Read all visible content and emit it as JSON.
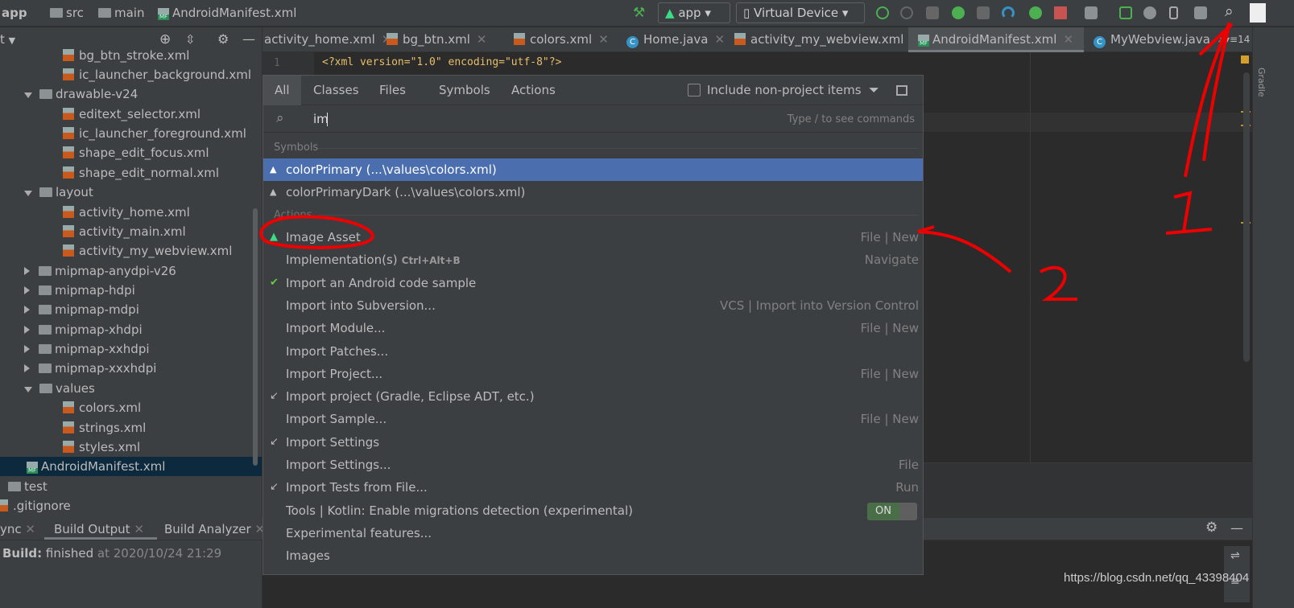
{
  "breadcrumb": [
    "app",
    "src",
    "main",
    "AndroidManifest.xml"
  ],
  "toolbar": {
    "run_config": "app",
    "device": "Virtual Device"
  },
  "project_panel": {
    "header": "t",
    "tree": [
      {
        "label": "bg_btn_stroke.xml",
        "type": "xml"
      },
      {
        "label": "ic_launcher_background.xml",
        "type": "xml"
      },
      {
        "label": "drawable-v24",
        "type": "folder-open"
      },
      {
        "label": "editext_selector.xml",
        "type": "xml"
      },
      {
        "label": "ic_launcher_foreground.xml",
        "type": "xml"
      },
      {
        "label": "shape_edit_focus.xml",
        "type": "xml"
      },
      {
        "label": "shape_edit_normal.xml",
        "type": "xml"
      },
      {
        "label": "layout",
        "type": "folder-open"
      },
      {
        "label": "activity_home.xml",
        "type": "xml"
      },
      {
        "label": "activity_main.xml",
        "type": "xml"
      },
      {
        "label": "activity_my_webview.xml",
        "type": "xml"
      },
      {
        "label": "mipmap-anydpi-v26",
        "type": "folder"
      },
      {
        "label": "mipmap-hdpi",
        "type": "folder"
      },
      {
        "label": "mipmap-mdpi",
        "type": "folder"
      },
      {
        "label": "mipmap-xhdpi",
        "type": "folder"
      },
      {
        "label": "mipmap-xxhdpi",
        "type": "folder"
      },
      {
        "label": "mipmap-xxxhdpi",
        "type": "folder"
      },
      {
        "label": "values",
        "type": "folder-open"
      },
      {
        "label": "colors.xml",
        "type": "xml"
      },
      {
        "label": "strings.xml",
        "type": "xml"
      },
      {
        "label": "styles.xml",
        "type": "xml"
      },
      {
        "label": "AndroidManifest.xml",
        "type": "manifest",
        "selected": true
      },
      {
        "label": "test",
        "type": "folder-plain"
      },
      {
        "label": ".gitignore",
        "type": "file"
      }
    ]
  },
  "editor_tabs": [
    {
      "label": "activity_home.xml",
      "icon": "none"
    },
    {
      "label": "bg_btn.xml",
      "icon": "xml"
    },
    {
      "label": "colors.xml",
      "icon": "xml"
    },
    {
      "label": "Home.java",
      "icon": "class"
    },
    {
      "label": "activity_my_webview.xml",
      "icon": "xml"
    },
    {
      "label": "AndroidManifest.xml",
      "icon": "manifest",
      "active": true
    },
    {
      "label": "MyWebview.java",
      "icon": "class"
    }
  ],
  "tab_overflow": "14",
  "editor": {
    "line_number": "1",
    "code": "<?xml version=\"1.0\" encoding=\"utf-8\"?>"
  },
  "search_popup": {
    "tabs": [
      "All",
      "Classes",
      "Files",
      "Symbols",
      "Actions"
    ],
    "active_tab": "All",
    "include_label": "Include non-project items",
    "query": "im",
    "hint": "Type / to see commands",
    "symbols_header": "Symbols",
    "symbols": [
      {
        "label": "colorPrimary (...\\values\\colors.xml)",
        "selected": true
      },
      {
        "label": "colorPrimaryDark (...\\values\\colors.xml)"
      }
    ],
    "actions_header": "Actions",
    "actions": [
      {
        "label": "Image Asset",
        "shortcut": "",
        "hint": "File | New",
        "icon": "android"
      },
      {
        "label": "Implementation(s)",
        "shortcut": "Ctrl+Alt+B",
        "hint": "Navigate",
        "icon": ""
      },
      {
        "label": "Import an Android code sample",
        "shortcut": "",
        "hint": "",
        "icon": "import-sample"
      },
      {
        "label": "Import into Subversion...",
        "shortcut": "",
        "hint": "VCS | Import into Version Control",
        "icon": ""
      },
      {
        "label": "Import Module...",
        "shortcut": "",
        "hint": "File | New",
        "icon": ""
      },
      {
        "label": "Import Patches...",
        "shortcut": "",
        "hint": "",
        "icon": ""
      },
      {
        "label": "Import Project...",
        "shortcut": "",
        "hint": "File | New",
        "icon": ""
      },
      {
        "label": "Import project (Gradle, Eclipse ADT, etc.)",
        "shortcut": "",
        "hint": "",
        "icon": "import"
      },
      {
        "label": "Import Sample...",
        "shortcut": "",
        "hint": "File | New",
        "icon": ""
      },
      {
        "label": "Import Settings",
        "shortcut": "",
        "hint": "",
        "icon": "import"
      },
      {
        "label": "Import Settings...",
        "shortcut": "",
        "hint": "File",
        "icon": ""
      },
      {
        "label": "Import Tests from File...",
        "shortcut": "",
        "hint": "Run",
        "icon": "import"
      },
      {
        "label": "Tools | Kotlin: Enable migrations detection (experimental)",
        "shortcut": "",
        "hint": "",
        "toggle": "ON",
        "icon": ""
      },
      {
        "label": "Experimental features...",
        "shortcut": "",
        "hint": "",
        "icon": ""
      },
      {
        "label": "Images",
        "shortcut": "",
        "hint": "",
        "icon": ""
      }
    ]
  },
  "bottom_panel": {
    "tabs": [
      "ync",
      "Build Output",
      "Build Analyzer"
    ],
    "active_tab": "Build Output",
    "status_bold": "Build:",
    "status_text": "finished",
    "status_time": "at 2020/10/24 21:29"
  },
  "annotations": [
    "1",
    "2"
  ],
  "watermark": "https://blog.csdn.net/qq_43398404",
  "colors": {
    "selection": "#4b6eaf",
    "tree_selection": "#0d293e",
    "annotation": "#e00000"
  }
}
